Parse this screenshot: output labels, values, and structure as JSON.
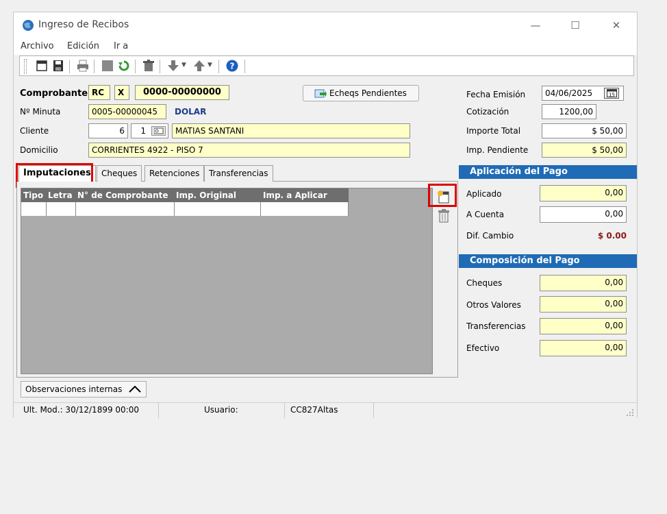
{
  "window": {
    "title": "Ingreso de Recibos",
    "minimize": "—",
    "maximize": "☐",
    "close": "✕"
  },
  "menu": [
    "Archivo",
    "Edición",
    "Ir a"
  ],
  "toolbar": {
    "icons": [
      "new-icon",
      "save-icon",
      "print-icon",
      "stop-icon",
      "refresh-icon",
      "delete-icon",
      "down-arrow-icon",
      "up-arrow-icon",
      "help-icon"
    ]
  },
  "header": {
    "comprobante_label": "Comprobante",
    "comprobante_tipo": "RC",
    "comprobante_letra": "X",
    "comprobante_numero": "0000-00000000",
    "minuta_label": "Nº Minuta",
    "minuta_value": "0005-00000045",
    "moneda": "DOLAR",
    "cliente_label": "Cliente",
    "cliente_codigo": "6",
    "cliente_sucursal": "1",
    "cliente_nombre": "MATIAS SANTANI",
    "domicilio_label": "Domicilio",
    "domicilio_value": "CORRIENTES 4922 - PISO 7",
    "echeqs_button": "Echeqs Pendientes",
    "fecha_label": "Fecha Emisión",
    "fecha_value": "04/06/2025",
    "cotizacion_label": "Cotización",
    "cotizacion_value": "1200,00",
    "importe_label": "Importe Total",
    "importe_value": "$ 50,00",
    "pendiente_label": "Imp. Pendiente",
    "pendiente_value": "$ 50,00"
  },
  "tabs": [
    "Imputaciones",
    "Cheques",
    "Retenciones",
    "Transferencias"
  ],
  "grid": {
    "columns": [
      "Tipo",
      "Letra",
      "N° de Comprobante",
      "Imp. Original",
      "Imp. a Aplicar"
    ]
  },
  "aplicacion": {
    "title": "Aplicación del Pago",
    "aplicado_label": "Aplicado",
    "aplicado_value": "0,00",
    "acuenta_label": "A Cuenta",
    "acuenta_value": "0,00",
    "difcambio_label": "Dif. Cambio",
    "difcambio_value": "$ 0.00"
  },
  "composicion": {
    "title": "Composición del Pago",
    "cheques_label": "Cheques",
    "cheques_value": "0,00",
    "otros_label": "Otros Valores",
    "otros_value": "0,00",
    "transf_label": "Transferencias",
    "transf_value": "0,00",
    "efectivo_label": "Efectivo",
    "efectivo_value": "0,00"
  },
  "observaciones_button": "Observaciones internas",
  "status": {
    "ult_mod": "Ult. Mod.: 30/12/1899 00:00",
    "usuario_label": "Usuario:",
    "usuario_value": "CC827Altas"
  },
  "colors": {
    "section_header": "#1f6bb5",
    "field_yellow": "#ffffc8",
    "highlight_red": "#e00000",
    "dif_cambio": "#8b1a1a"
  }
}
